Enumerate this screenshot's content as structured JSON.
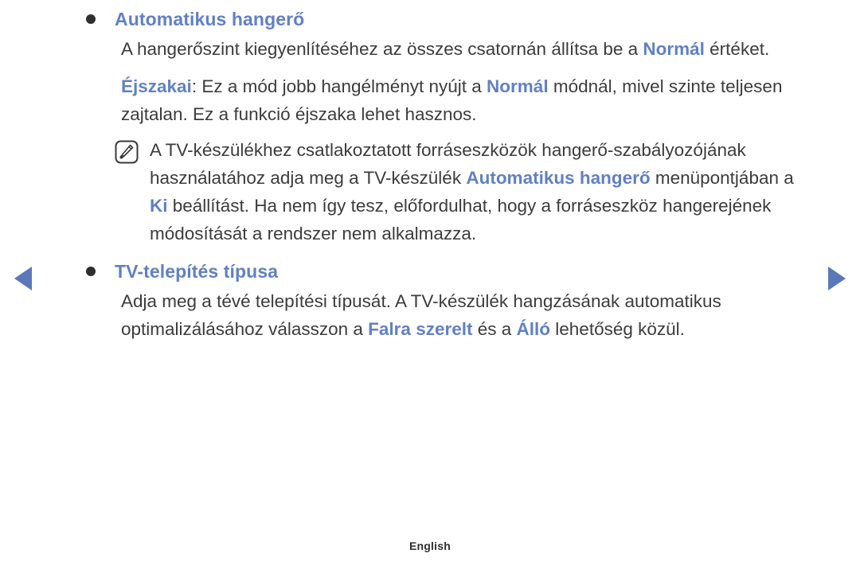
{
  "nav": {
    "prev_label": "previous-page",
    "next_label": "next-page",
    "arrow_color": "#5a79ba"
  },
  "colors": {
    "keyword_blue": "#6180c4",
    "body_text": "#3c3c3c",
    "bullet": "#2f2f2f"
  },
  "sections": [
    {
      "heading": "Automatikus hangerő",
      "paragraphs": [
        {
          "parts": [
            {
              "text": "A hangerőszint kiegyenlítéséhez az összes csatornán állítsa be a ",
              "style": "normal"
            },
            {
              "text": "Normál",
              "style": "keyword"
            },
            {
              "text": " értéket.",
              "style": "normal"
            }
          ]
        },
        {
          "parts": [
            {
              "text": "Éjszakai",
              "style": "keyword"
            },
            {
              "text": ": Ez a mód jobb hangélményt nyújt a ",
              "style": "normal"
            },
            {
              "text": "Normál",
              "style": "keyword"
            },
            {
              "text": " módnál, mivel szinte teljesen zajtalan. Ez a funkció éjszaka lehet hasznos.",
              "style": "normal"
            }
          ]
        }
      ],
      "note": {
        "icon": "note-pencil-icon",
        "parts": [
          {
            "text": "A TV-készülékhez csatlakoztatott forráseszközök hangerő-szabályozójának használatához adja meg a TV-készülék ",
            "style": "normal"
          },
          {
            "text": "Automatikus hangerő",
            "style": "keyword"
          },
          {
            "text": " menüpontjában a ",
            "style": "normal"
          },
          {
            "text": "Ki",
            "style": "keyword"
          },
          {
            "text": " beállítást. Ha nem így tesz, előfordulhat, hogy a forráseszköz hangerejének módosítását a rendszer nem alkalmazza.",
            "style": "normal"
          }
        ]
      }
    },
    {
      "heading": "TV-telepítés típusa",
      "paragraphs": [
        {
          "parts": [
            {
              "text": "Adja meg a tévé telepítési típusát. A TV-készülék hangzásának automatikus optimalizálásához válasszon a ",
              "style": "normal"
            },
            {
              "text": "Falra szerelt",
              "style": "keyword"
            },
            {
              "text": " és a ",
              "style": "normal"
            },
            {
              "text": "Álló",
              "style": "keyword"
            },
            {
              "text": " lehetőség közül.",
              "style": "normal"
            }
          ]
        }
      ],
      "note": null
    }
  ],
  "footer": {
    "language": "English"
  }
}
